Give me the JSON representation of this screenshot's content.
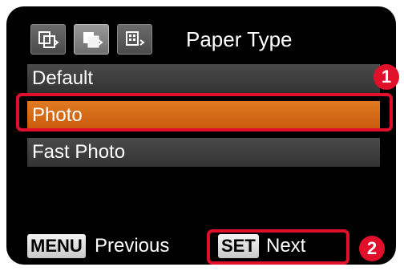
{
  "header": {
    "tabs": [
      {
        "icon": "page-layout-icon",
        "active": false
      },
      {
        "icon": "paper-icon",
        "active": true
      },
      {
        "icon": "print-settings-icon",
        "active": false
      }
    ],
    "title": "Paper Type"
  },
  "menu": {
    "items": [
      {
        "label": "Default"
      },
      {
        "label": "Photo",
        "selected": true
      },
      {
        "label": "Fast Photo"
      }
    ]
  },
  "annotations": {
    "badge_1": "1",
    "badge_2": "2",
    "highlight_color": "#e0102a"
  },
  "footer": {
    "menu_key": "MENU",
    "menu_label": "Previous",
    "set_key": "SET",
    "set_label": "Next"
  },
  "colors": {
    "selected_row": "#d26a16",
    "row": "#3d3d3d",
    "screen": "#000000"
  }
}
